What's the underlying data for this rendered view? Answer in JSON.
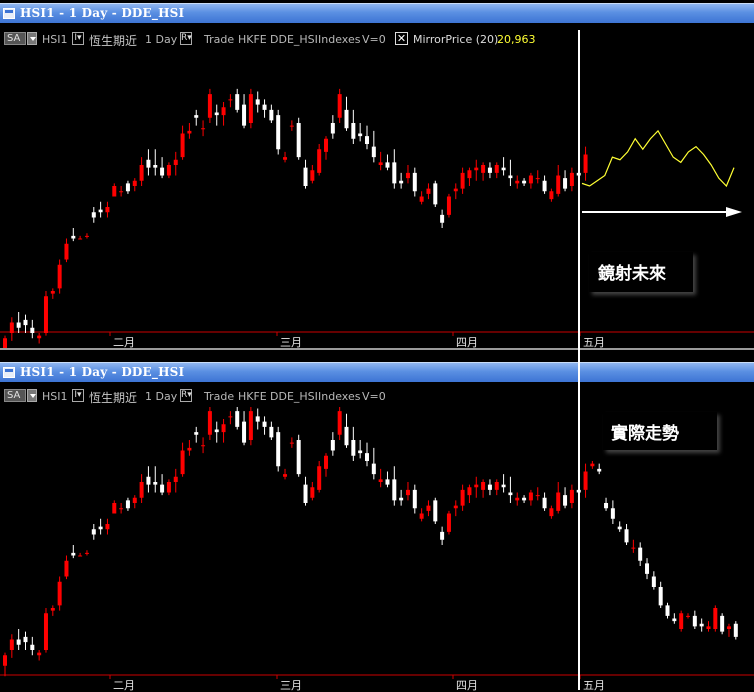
{
  "panels": [
    {
      "title": "HSI1 - 1 Day - DDE_HSI",
      "toolbar": {
        "period": "SA",
        "symbol": "HSI1",
        "name": "恆生期近",
        "interval": "1 Day",
        "mode": "Trade",
        "exchange": "HKFE",
        "feed": "DDE_HSI",
        "type": "Indexes",
        "volume": "V=0",
        "indicator": "MirrorPrice (20)",
        "indicator_value": "20,963"
      },
      "annotation": "鏡射未來"
    },
    {
      "title": "HSI1 - 1 Day - DDE_HSI",
      "toolbar": {
        "period": "SA",
        "symbol": "HSI1",
        "name": "恆生期近",
        "interval": "1 Day",
        "mode": "Trade",
        "exchange": "HKFE",
        "feed": "DDE_HSI",
        "type": "Indexes",
        "volume": "V=0"
      },
      "annotation": "實際走勢"
    }
  ],
  "chart_data": [
    {
      "type": "candlestick",
      "title": "HSI1 - 1 Day - DDE_HSI",
      "x_tick_labels": [
        "二月",
        "三月",
        "四月",
        "五月"
      ],
      "up_color": "#ff0000",
      "down_color": "#ffffff",
      "candles": [
        [
          22.0,
          22.5,
          21.6,
          22.4
        ],
        [
          22.6,
          23.2,
          22.3,
          23.0
        ],
        [
          23.0,
          23.4,
          22.6,
          22.8
        ],
        [
          23.1,
          23.3,
          22.6,
          22.9
        ],
        [
          22.8,
          23.1,
          22.4,
          22.6
        ],
        [
          22.4,
          22.6,
          22.2,
          22.5
        ],
        [
          22.6,
          24.2,
          22.5,
          24.0
        ],
        [
          24.1,
          24.3,
          23.9,
          24.2
        ],
        [
          24.3,
          25.4,
          24.1,
          25.2
        ],
        [
          25.4,
          26.2,
          25.3,
          26.0
        ],
        [
          26.3,
          26.6,
          26.1,
          26.2
        ],
        [
          26.2,
          26.3,
          26.2,
          26.2
        ],
        [
          26.3,
          26.4,
          26.2,
          26.3
        ],
        [
          27.2,
          27.4,
          26.8,
          27.0
        ],
        [
          27.3,
          27.6,
          27.0,
          27.2
        ],
        [
          27.2,
          27.6,
          27.0,
          27.4
        ],
        [
          27.8,
          28.3,
          27.8,
          28.2
        ],
        [
          28.0,
          28.2,
          27.8,
          28.0
        ],
        [
          28.3,
          28.4,
          27.9,
          28.0
        ],
        [
          28.2,
          28.5,
          28.0,
          28.4
        ],
        [
          28.4,
          29.3,
          28.2,
          29.0
        ],
        [
          29.2,
          29.6,
          28.6,
          28.9
        ],
        [
          29.0,
          29.6,
          28.6,
          28.9
        ],
        [
          28.9,
          29.3,
          28.5,
          28.6
        ],
        [
          28.6,
          29.1,
          28.5,
          29.0
        ],
        [
          29.0,
          29.5,
          28.6,
          29.2
        ],
        [
          29.3,
          30.5,
          29.2,
          30.2
        ],
        [
          30.2,
          30.6,
          30.0,
          30.3
        ],
        [
          30.9,
          31.1,
          30.5,
          30.8
        ],
        [
          30.4,
          30.7,
          30.1,
          30.4
        ],
        [
          30.8,
          31.9,
          30.6,
          31.7
        ],
        [
          31.0,
          31.3,
          30.5,
          30.9
        ],
        [
          30.9,
          31.4,
          30.5,
          31.2
        ],
        [
          31.5,
          31.7,
          31.2,
          31.5
        ],
        [
          31.7,
          31.9,
          31.0,
          31.1
        ],
        [
          31.3,
          31.7,
          30.4,
          30.5
        ],
        [
          30.6,
          31.9,
          30.4,
          31.7
        ],
        [
          31.5,
          31.8,
          31.0,
          31.3
        ],
        [
          31.3,
          31.5,
          30.8,
          31.1
        ],
        [
          31.1,
          31.3,
          30.6,
          30.7
        ],
        [
          30.9,
          31.1,
          29.4,
          29.6
        ],
        [
          29.2,
          29.5,
          29.1,
          29.3
        ],
        [
          30.5,
          30.7,
          30.3,
          30.5
        ],
        [
          30.6,
          30.8,
          29.2,
          29.3
        ],
        [
          28.9,
          29.2,
          28.1,
          28.2
        ],
        [
          28.4,
          29.0,
          28.3,
          28.8
        ],
        [
          28.7,
          29.8,
          28.6,
          29.6
        ],
        [
          29.5,
          30.1,
          29.2,
          30.0
        ],
        [
          30.6,
          30.9,
          30.0,
          30.2
        ],
        [
          30.8,
          31.9,
          30.6,
          31.7
        ],
        [
          31.1,
          31.6,
          30.3,
          30.4
        ],
        [
          30.6,
          31.1,
          29.8,
          30.0
        ],
        [
          30.2,
          30.6,
          29.9,
          30.1
        ],
        [
          30.1,
          30.5,
          29.6,
          29.8
        ],
        [
          29.7,
          30.3,
          29.1,
          29.3
        ],
        [
          29.0,
          29.5,
          28.8,
          29.1
        ],
        [
          29.1,
          29.4,
          28.8,
          28.9
        ],
        [
          29.1,
          29.6,
          28.1,
          28.3
        ],
        [
          28.4,
          28.7,
          28.1,
          28.3
        ],
        [
          28.5,
          29.0,
          28.3,
          28.7
        ],
        [
          28.7,
          28.9,
          27.8,
          28.0
        ],
        [
          27.6,
          28.0,
          27.5,
          27.8
        ],
        [
          27.9,
          28.3,
          27.7,
          28.1
        ],
        [
          28.3,
          28.4,
          27.4,
          27.5
        ],
        [
          27.1,
          27.3,
          26.6,
          26.8
        ],
        [
          27.1,
          27.9,
          27.0,
          27.8
        ],
        [
          28.0,
          28.3,
          27.7,
          28.1
        ],
        [
          28.1,
          28.9,
          27.9,
          28.7
        ],
        [
          28.5,
          28.9,
          28.2,
          28.8
        ],
        [
          28.8,
          29.2,
          28.4,
          28.9
        ],
        [
          28.7,
          29.1,
          28.4,
          29.0
        ],
        [
          28.9,
          29.1,
          28.5,
          28.7
        ],
        [
          28.7,
          29.1,
          28.5,
          29.0
        ],
        [
          28.9,
          29.3,
          28.6,
          28.8
        ],
        [
          28.6,
          29.2,
          28.2,
          28.5
        ],
        [
          28.3,
          28.6,
          28.1,
          28.4
        ],
        [
          28.4,
          28.5,
          28.2,
          28.3
        ],
        [
          28.3,
          28.7,
          28.1,
          28.6
        ],
        [
          28.5,
          28.8,
          28.3,
          28.5
        ],
        [
          28.4,
          28.6,
          27.9,
          28.0
        ],
        [
          27.7,
          28.1,
          27.6,
          28.0
        ],
        [
          27.9,
          29.0,
          27.8,
          28.6
        ],
        [
          28.5,
          28.8,
          28.0,
          28.1
        ],
        [
          28.2,
          28.9,
          28.0,
          28.7
        ],
        [
          28.7,
          29.0,
          28.4,
          28.6
        ],
        [
          28.7,
          29.7,
          28.4,
          29.4
        ]
      ],
      "mirror_line": [
        28.3,
        28.2,
        28.4,
        28.6,
        29.3,
        29.2,
        29.5,
        30.0,
        29.6,
        30.0,
        30.3,
        29.8,
        29.3,
        29.1,
        29.5,
        29.7,
        29.4,
        29.0,
        28.5,
        28.2,
        28.9
      ]
    },
    {
      "type": "candlestick",
      "title": "HSI1 - 1 Day - DDE_HSI",
      "x_tick_labels": [
        "二月",
        "三月",
        "四月",
        "五月"
      ],
      "up_color": "#ff0000",
      "down_color": "#ffffff",
      "candles": [
        [
          22.0,
          22.5,
          21.6,
          22.4
        ],
        [
          22.6,
          23.2,
          22.3,
          23.0
        ],
        [
          23.0,
          23.4,
          22.6,
          22.8
        ],
        [
          23.1,
          23.3,
          22.6,
          22.9
        ],
        [
          22.8,
          23.1,
          22.4,
          22.6
        ],
        [
          22.4,
          22.6,
          22.2,
          22.5
        ],
        [
          22.6,
          24.2,
          22.5,
          24.0
        ],
        [
          24.1,
          24.3,
          23.9,
          24.2
        ],
        [
          24.3,
          25.4,
          24.1,
          25.2
        ],
        [
          25.4,
          26.2,
          25.3,
          26.0
        ],
        [
          26.3,
          26.6,
          26.1,
          26.2
        ],
        [
          26.2,
          26.3,
          26.2,
          26.2
        ],
        [
          26.3,
          26.4,
          26.2,
          26.3
        ],
        [
          27.2,
          27.4,
          26.8,
          27.0
        ],
        [
          27.3,
          27.6,
          27.0,
          27.2
        ],
        [
          27.2,
          27.6,
          27.0,
          27.4
        ],
        [
          27.8,
          28.3,
          27.8,
          28.2
        ],
        [
          28.0,
          28.2,
          27.8,
          28.0
        ],
        [
          28.3,
          28.4,
          27.9,
          28.0
        ],
        [
          28.2,
          28.5,
          28.0,
          28.4
        ],
        [
          28.4,
          29.3,
          28.2,
          29.0
        ],
        [
          29.2,
          29.6,
          28.6,
          28.9
        ],
        [
          29.0,
          29.6,
          28.6,
          28.9
        ],
        [
          28.9,
          29.3,
          28.5,
          28.6
        ],
        [
          28.6,
          29.1,
          28.5,
          29.0
        ],
        [
          29.0,
          29.5,
          28.6,
          29.2
        ],
        [
          29.3,
          30.5,
          29.2,
          30.2
        ],
        [
          30.2,
          30.6,
          30.0,
          30.3
        ],
        [
          30.9,
          31.1,
          30.5,
          30.8
        ],
        [
          30.4,
          30.7,
          30.1,
          30.4
        ],
        [
          30.8,
          31.9,
          30.6,
          31.7
        ],
        [
          31.0,
          31.3,
          30.5,
          30.9
        ],
        [
          30.9,
          31.4,
          30.5,
          31.2
        ],
        [
          31.5,
          31.7,
          31.2,
          31.5
        ],
        [
          31.7,
          31.9,
          31.0,
          31.1
        ],
        [
          31.3,
          31.7,
          30.4,
          30.5
        ],
        [
          30.6,
          31.9,
          30.4,
          31.7
        ],
        [
          31.5,
          31.8,
          31.0,
          31.3
        ],
        [
          31.3,
          31.5,
          30.8,
          31.1
        ],
        [
          31.1,
          31.3,
          30.6,
          30.7
        ],
        [
          30.9,
          31.1,
          29.4,
          29.6
        ],
        [
          29.2,
          29.5,
          29.1,
          29.3
        ],
        [
          30.5,
          30.7,
          30.3,
          30.5
        ],
        [
          30.6,
          30.8,
          29.2,
          29.3
        ],
        [
          28.9,
          29.2,
          28.1,
          28.2
        ],
        [
          28.4,
          29.0,
          28.3,
          28.8
        ],
        [
          28.7,
          29.8,
          28.6,
          29.6
        ],
        [
          29.5,
          30.1,
          29.2,
          30.0
        ],
        [
          30.6,
          30.9,
          30.0,
          30.2
        ],
        [
          30.8,
          31.9,
          30.6,
          31.7
        ],
        [
          31.1,
          31.6,
          30.3,
          30.4
        ],
        [
          30.6,
          31.1,
          29.8,
          30.0
        ],
        [
          30.2,
          30.6,
          29.9,
          30.1
        ],
        [
          30.1,
          30.5,
          29.6,
          29.8
        ],
        [
          29.7,
          30.3,
          29.1,
          29.3
        ],
        [
          29.0,
          29.5,
          28.8,
          29.1
        ],
        [
          29.1,
          29.4,
          28.8,
          28.9
        ],
        [
          29.1,
          29.6,
          28.1,
          28.3
        ],
        [
          28.4,
          28.7,
          28.1,
          28.3
        ],
        [
          28.5,
          29.0,
          28.3,
          28.7
        ],
        [
          28.7,
          28.9,
          27.8,
          28.0
        ],
        [
          27.6,
          28.0,
          27.5,
          27.8
        ],
        [
          27.9,
          28.3,
          27.7,
          28.1
        ],
        [
          28.3,
          28.4,
          27.4,
          27.5
        ],
        [
          27.1,
          27.3,
          26.6,
          26.8
        ],
        [
          27.1,
          27.9,
          27.0,
          27.8
        ],
        [
          28.0,
          28.3,
          27.7,
          28.1
        ],
        [
          28.1,
          28.9,
          27.9,
          28.7
        ],
        [
          28.5,
          28.9,
          28.2,
          28.8
        ],
        [
          28.8,
          29.2,
          28.4,
          28.9
        ],
        [
          28.7,
          29.1,
          28.4,
          29.0
        ],
        [
          28.9,
          29.1,
          28.5,
          28.7
        ],
        [
          28.7,
          29.1,
          28.5,
          29.0
        ],
        [
          28.9,
          29.3,
          28.6,
          28.8
        ],
        [
          28.6,
          29.2,
          28.2,
          28.5
        ],
        [
          28.3,
          28.6,
          28.1,
          28.4
        ],
        [
          28.4,
          28.5,
          28.2,
          28.3
        ],
        [
          28.3,
          28.7,
          28.1,
          28.6
        ],
        [
          28.5,
          28.8,
          28.3,
          28.5
        ],
        [
          28.4,
          28.6,
          27.9,
          28.0
        ],
        [
          27.7,
          28.1,
          27.6,
          28.0
        ],
        [
          27.9,
          29.0,
          27.8,
          28.6
        ],
        [
          28.5,
          28.8,
          28.0,
          28.1
        ],
        [
          28.2,
          28.9,
          28.0,
          28.7
        ],
        [
          28.7,
          29.0,
          28.4,
          28.6
        ],
        [
          28.7,
          29.7,
          28.4,
          29.4
        ],
        [
          29.6,
          29.8,
          29.5,
          29.7
        ],
        [
          29.5,
          29.7,
          29.3,
          29.4
        ],
        [
          28.2,
          28.4,
          27.9,
          28.0
        ],
        [
          28.0,
          28.3,
          27.4,
          27.6
        ],
        [
          27.3,
          27.5,
          27.1,
          27.2
        ],
        [
          27.2,
          27.4,
          26.6,
          26.7
        ],
        [
          26.5,
          26.8,
          26.3,
          26.5
        ],
        [
          26.5,
          26.7,
          25.8,
          26.0
        ],
        [
          25.9,
          26.1,
          25.3,
          25.5
        ],
        [
          25.4,
          25.6,
          24.9,
          25.0
        ],
        [
          25.0,
          25.2,
          24.2,
          24.3
        ],
        [
          24.3,
          24.4,
          23.8,
          23.9
        ],
        [
          23.8,
          24.0,
          23.6,
          23.7
        ],
        [
          23.4,
          24.1,
          23.3,
          24.0
        ],
        [
          23.9,
          24.0,
          23.8,
          23.9
        ],
        [
          23.9,
          24.1,
          23.4,
          23.5
        ],
        [
          23.6,
          23.8,
          23.3,
          23.5
        ],
        [
          23.4,
          23.7,
          23.3,
          23.5
        ],
        [
          23.4,
          24.3,
          23.3,
          24.2
        ],
        [
          23.9,
          24.0,
          23.2,
          23.3
        ],
        [
          23.4,
          23.6,
          23.1,
          23.5
        ],
        [
          23.6,
          23.7,
          23.0,
          23.1
        ]
      ],
      "mirror_line": []
    }
  ]
}
